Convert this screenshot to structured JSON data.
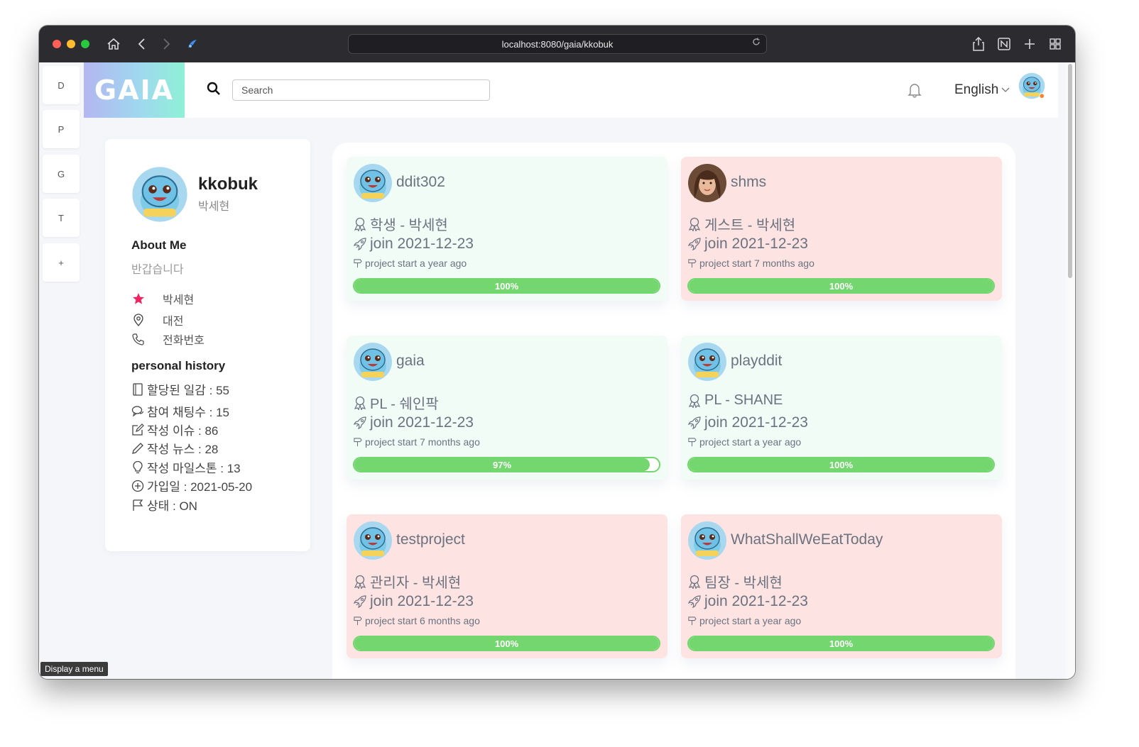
{
  "browser": {
    "url": "localhost:8080/gaia/kkobuk",
    "colors": {
      "close": "#fe5f57",
      "minimize": "#febc2e",
      "maximize": "#28c840"
    }
  },
  "vtabs": [
    "D",
    "P",
    "G",
    "T",
    "+"
  ],
  "tooltip": "Display a menu",
  "header": {
    "logo": "GAIA",
    "search_placeholder": "Search",
    "language": "English"
  },
  "profile": {
    "name": "kkobuk",
    "sub": "박세현",
    "about_title": "About Me",
    "about_text": "반갑습니다",
    "info": [
      {
        "icon": "star-icon",
        "text": "박세현"
      },
      {
        "icon": "location-pin-icon",
        "text": "대전"
      },
      {
        "icon": "phone-icon",
        "text": "전화번호"
      }
    ],
    "history_title": "personal history",
    "history": [
      {
        "icon": "notebook-icon",
        "text": "할당된 일감 : 55"
      },
      {
        "icon": "chat-bubbles-icon",
        "text": "참여 채팅수 : 15"
      },
      {
        "icon": "edit-square-icon",
        "text": "작성 이슈 : 86"
      },
      {
        "icon": "pencil-icon",
        "text": "작성 뉴스 : 28"
      },
      {
        "icon": "lightbulb-icon",
        "text": "작성 마일스톤 : 13"
      },
      {
        "icon": "plus-circle-icon",
        "text": "가입일 : 2021-05-20"
      },
      {
        "icon": "flag-icon",
        "text": "상태 : ON"
      }
    ]
  },
  "projects": [
    {
      "name": "ddit302",
      "role": "학생 - 박세현",
      "join": "join 2021-12-23",
      "start": "project start a year ago",
      "progress": 100,
      "progress_label": "100%",
      "theme": "mint",
      "avatar": "squirtle"
    },
    {
      "name": "shms",
      "role": "게스트 - 박세현",
      "join": "join 2021-12-23",
      "start": "project start 7 months ago",
      "progress": 100,
      "progress_label": "100%",
      "theme": "pink",
      "avatar": "woman"
    },
    {
      "name": "gaia",
      "role": "PL - 쉐인팍",
      "join": "join 2021-12-23",
      "start": "project start 7 months ago",
      "progress": 97,
      "progress_label": "97%",
      "theme": "mint",
      "avatar": "squirtle"
    },
    {
      "name": "playddit",
      "role": "PL - SHANE",
      "join": "join 2021-12-23",
      "start": "project start a year ago",
      "progress": 100,
      "progress_label": "100%",
      "theme": "mint",
      "avatar": "squirtle"
    },
    {
      "name": "testproject",
      "role": "관리자 - 박세현",
      "join": "join 2021-12-23",
      "start": "project start 6 months ago",
      "progress": 100,
      "progress_label": "100%",
      "theme": "pink",
      "avatar": "squirtle"
    },
    {
      "name": "WhatShallWeEatToday",
      "role": "팀장 - 박세현",
      "join": "join 2021-12-23",
      "start": "project start a year ago",
      "progress": 100,
      "progress_label": "100%",
      "theme": "pink",
      "avatar": "squirtle"
    }
  ]
}
